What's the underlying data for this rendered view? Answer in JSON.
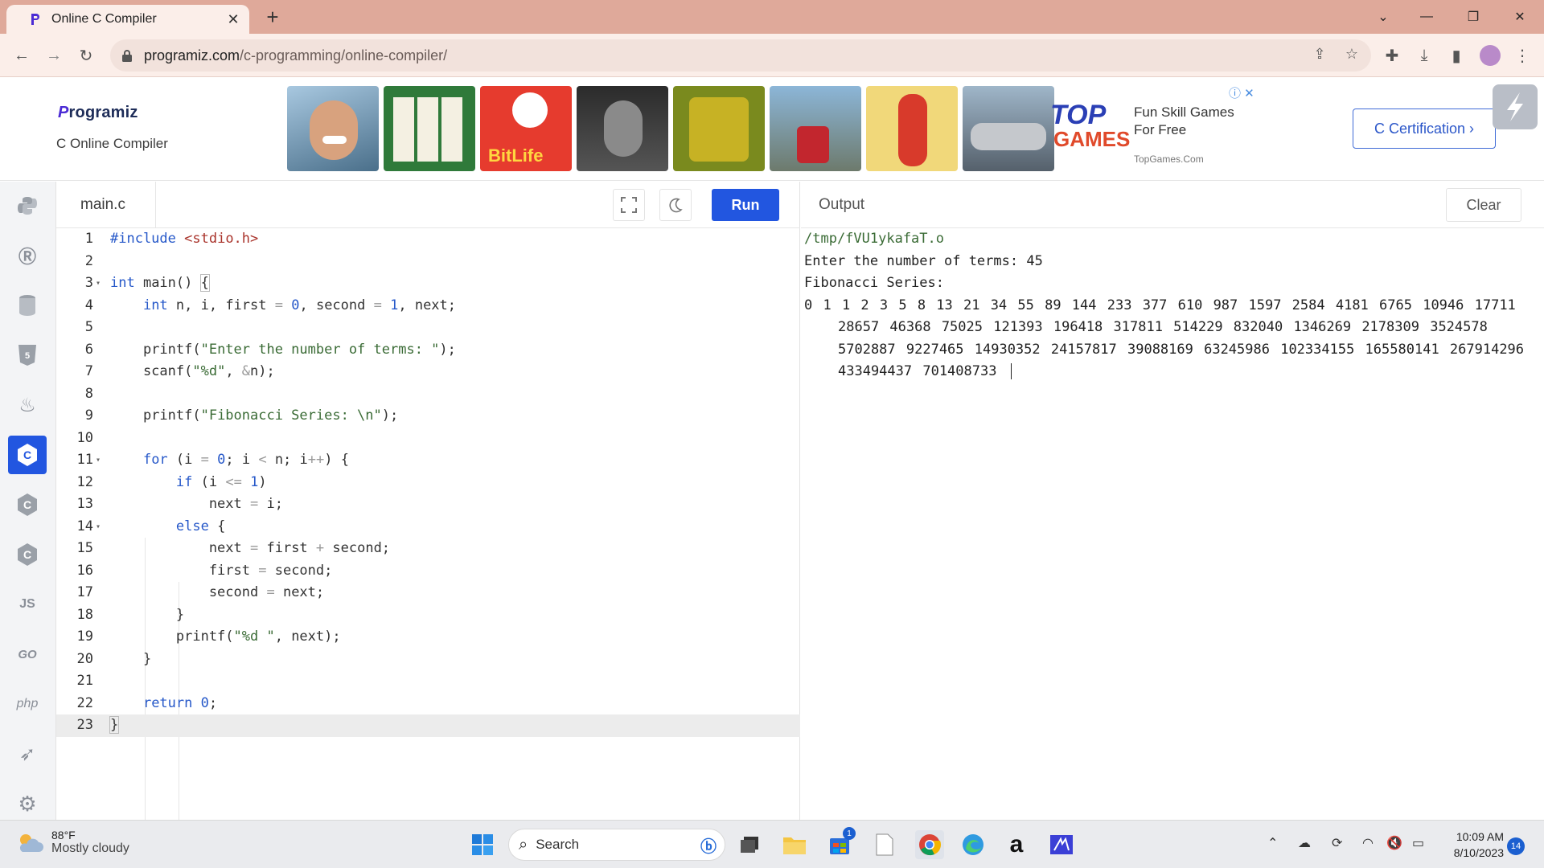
{
  "browser": {
    "tab_title": "Online C Compiler",
    "url_host": "programiz.com",
    "url_path": "/c-programming/online-compiler/"
  },
  "site": {
    "logo_first": "P",
    "logo_rest": "rogramiz",
    "subtitle": "C Online Compiler",
    "ad_title_line1": "Fun Skill Games",
    "ad_title_line2": "For Free",
    "ad_source": "TopGames.Com",
    "ad_logo_top": "TOP",
    "ad_logo_bottom": "GAMES",
    "ad_tile_label": "BitLife",
    "cert_button": "C Certification ›"
  },
  "sidebar": {
    "items": [
      "python-icon",
      "r-icon",
      "sql-icon",
      "html-icon",
      "java-icon",
      "c-icon",
      "cpp-icon",
      "csharp-icon",
      "js-icon",
      "go-icon",
      "php-icon",
      "swift-icon",
      "rust-icon"
    ],
    "labels": {
      "js": "JS",
      "go": "GO",
      "php": "php"
    },
    "active": "c-icon"
  },
  "editor": {
    "file_name": "main.c",
    "run_label": "Run"
  },
  "output": {
    "title": "Output",
    "clear_label": "Clear",
    "path_line": "/tmp/fVU1ykafaT.o",
    "prompt_line": "Enter the number of terms: 45",
    "series_label": "Fibonacci Series:",
    "series_values": "0 1 1 2 3 5 8 13 21 34 55 89 144 233 377 610 987 1597 2584 4181 6765 10946 17711 28657 46368 75025 121393 196418 317811 514229 832040 1346269 2178309 3524578 5702887 9227465 14930352 24157817 39088169 63245986 102334155 165580141 267914296 433494437 701408733"
  },
  "taskbar": {
    "temp": "88°F",
    "condition": "Mostly cloudy",
    "search_placeholder": "Search",
    "time": "10:09 AM",
    "date": "8/10/2023",
    "notifications": "14",
    "store_badge": "1"
  },
  "colors": {
    "accent": "#2256e0",
    "titlebar": "#dfa99a",
    "toolbar": "#fbeee9"
  }
}
